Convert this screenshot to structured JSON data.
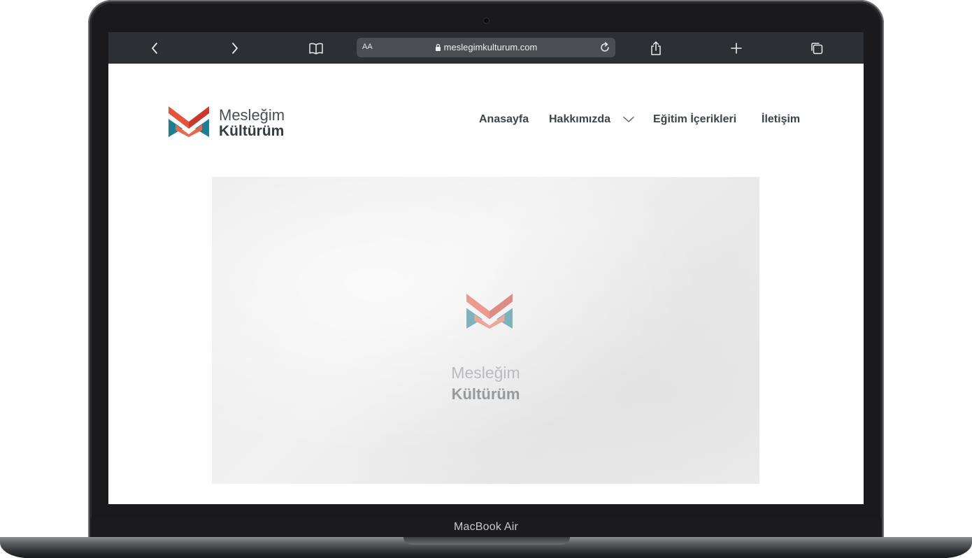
{
  "device": {
    "label": "MacBook Air"
  },
  "browser": {
    "text_size_label": "AA",
    "url": "meslegimkulturum.com"
  },
  "site": {
    "logo": {
      "line1": "Mesleğim",
      "line2": "Kültürüm"
    },
    "nav": [
      {
        "label": "Anasayfa"
      },
      {
        "label": "Hakkımızda"
      },
      {
        "label": "Eğitim İçerikleri"
      },
      {
        "label": "İletişim"
      }
    ]
  },
  "hero": {
    "line1": "Mesleğim",
    "line2": "Kültürüm"
  },
  "colors": {
    "logo_orange": "#e5533a",
    "logo_red": "#c83a2c",
    "logo_teal": "#1f7f90",
    "toolbar_bg": "#2c2f33"
  }
}
